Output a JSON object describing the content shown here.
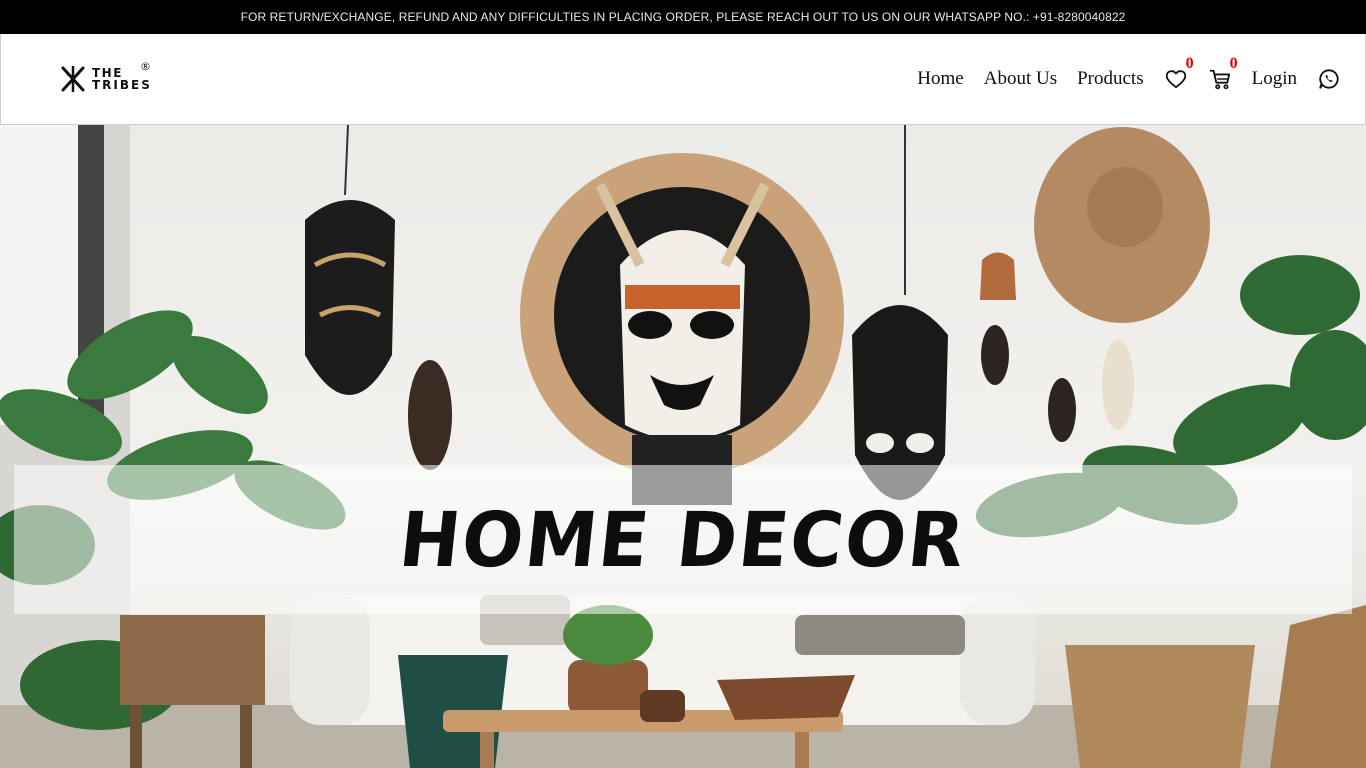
{
  "announcement": "FOR RETURN/EXCHANGE, REFUND AND ANY DIFFICULTIES IN PLACING ORDER, PLEASE REACH OUT TO US ON OUR WHATSAPP NO.: +91-8280040822",
  "logo": {
    "line1": "THE",
    "line2": "TRIBES",
    "reg": "®"
  },
  "nav": {
    "home": "Home",
    "about": "About Us",
    "products": "Products",
    "wishlist_count": "0",
    "cart_count": "0",
    "login": "Login"
  },
  "icons": {
    "wishlist": "heart-icon",
    "cart": "cart-icon",
    "whatsapp": "whatsapp-icon"
  },
  "hero": {
    "title": "HOME DECOR"
  },
  "colors": {
    "badge": "#e00000",
    "announce_bg": "#000000"
  }
}
